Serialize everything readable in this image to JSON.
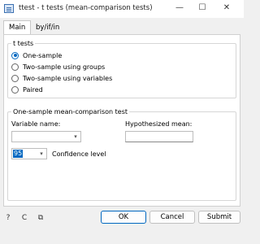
{
  "window": {
    "title": "ttest - t tests (mean-comparison tests)",
    "minimize": "—",
    "maximize": "☐",
    "close": "✕"
  },
  "tabs": [
    {
      "label": "Main",
      "active": true
    },
    {
      "label": "by/if/in",
      "active": false
    }
  ],
  "ttests": {
    "group_label": "t tests",
    "options": [
      {
        "label": "One-sample",
        "checked": true
      },
      {
        "label": "Two-sample using groups",
        "checked": false
      },
      {
        "label": "Two-sample using variables",
        "checked": false
      },
      {
        "label": "Paired",
        "checked": false
      }
    ]
  },
  "one_sample": {
    "group_label": "One-sample mean-comparison test",
    "variable_name_label": "Variable name:",
    "variable_name_value": "",
    "hypothesized_mean_label": "Hypothesized mean:",
    "hypothesized_mean_value": "",
    "confidence_value": "95",
    "confidence_label": "Confidence level"
  },
  "footer": {
    "help_icon": "?",
    "reset_icon": "C",
    "copy_icon": "⧉",
    "ok_label": "OK",
    "cancel_label": "Cancel",
    "submit_label": "Submit"
  },
  "colors": {
    "accent": "#0067c0",
    "background": "#f0f0f0"
  }
}
